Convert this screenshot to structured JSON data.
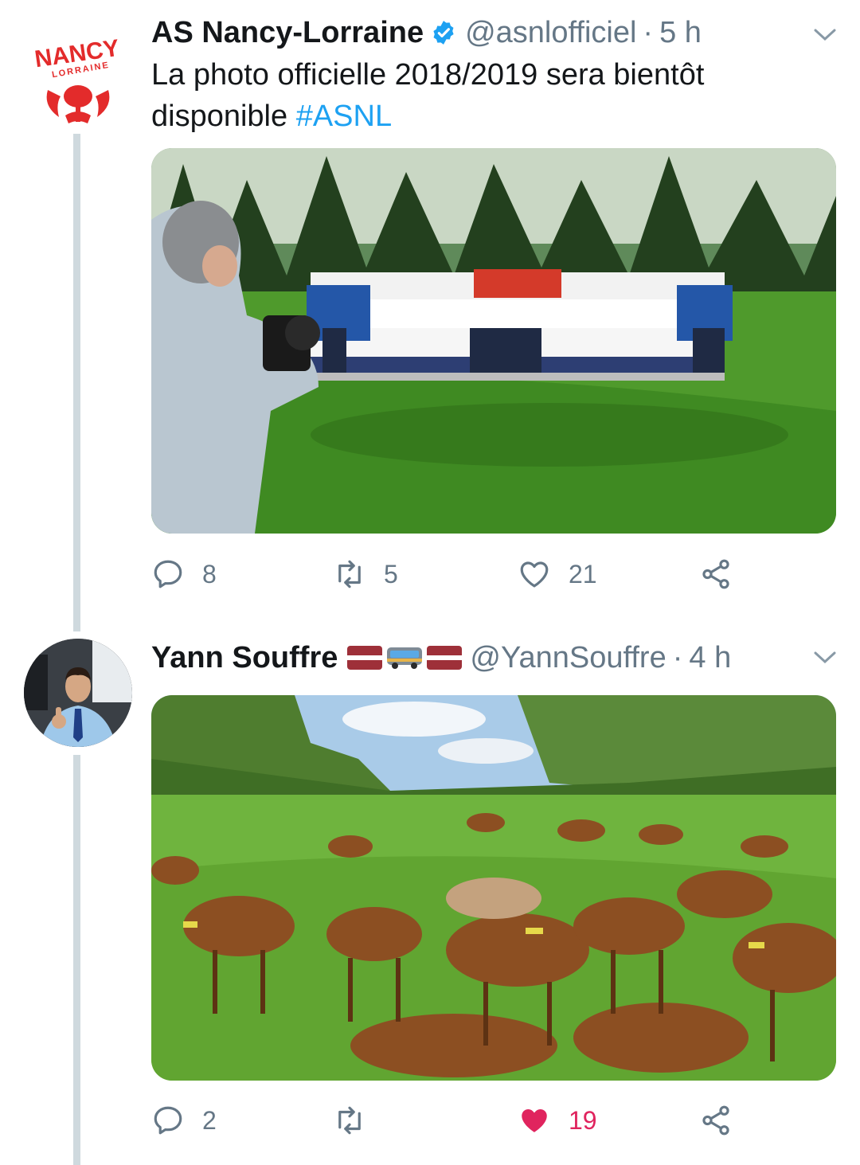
{
  "tweets": [
    {
      "display_name": "AS Nancy-Lorraine",
      "handle": "@asnlofficiel",
      "separator": "·",
      "time": "5 h",
      "avatar_icon": "asnl-club-logo",
      "logo_text_top": "NANCY",
      "logo_text_bottom": "LORRAINE",
      "verified": true,
      "text": "La photo officielle 2018/2019 sera bientôt disponible",
      "hashtag": "#ASNL",
      "media_icon": "team-photo-shoot",
      "replies": "8",
      "retweets": "5",
      "likes": "21",
      "liked": false
    },
    {
      "display_name": "Yann Souffre",
      "handle": "@YannSouffre",
      "separator": "·",
      "time": "4 h",
      "avatar_icon": "user-avatar-driver",
      "name_emojis": [
        "latvia-flag-icon",
        "bus-icon",
        "latvia-flag-icon"
      ],
      "media_icon": "goats-in-meadow",
      "replies": "2",
      "retweets": "",
      "likes": "19",
      "liked": true
    }
  ],
  "colors": {
    "link": "#1da1f2",
    "secondary_text": "#657786",
    "like": "#e0245e",
    "thread_line": "#cfd9de",
    "club_red": "#e32b2b"
  }
}
